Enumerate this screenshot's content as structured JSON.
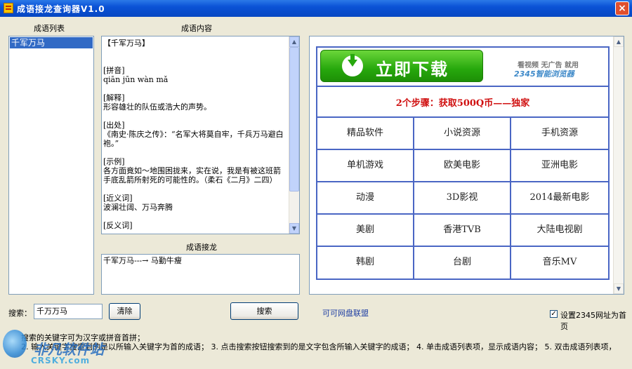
{
  "window": {
    "title": "成语接龙查询器V1.0"
  },
  "labels": {
    "idiom_list": "成语列表",
    "idiom_content": "成语内容",
    "idiom_chain": "成语接龙",
    "search": "搜索："
  },
  "list": {
    "items": [
      "千军万马"
    ]
  },
  "content": {
    "text": "【千军万马】\n\n\n[拼音]\nqiān jūn wàn mǎ\n\n[解释]\n形容雄壮的队伍或浩大的声势。\n\n[出处]\n《南史·陈庆之传》：“名军大将莫自牢，千兵万马避白袍。”\n\n[示例]\n各方面竟如～地围困拢来，实在说，我是有被这班箭手底乱箭所射死的可能性的。（柔石《二月》二四）\n\n[近义词]\n波澜壮阔、万马奔腾\n\n[反义词]"
  },
  "chain": {
    "text": "千军万马---→ 马勤牛瘦"
  },
  "search": {
    "value": "千万万马",
    "clear_label": "清除",
    "search_label": "搜索"
  },
  "link": {
    "text": "可可网盘联盟"
  },
  "homepage": {
    "checked": true,
    "label": "设置2345网址为首页"
  },
  "ad": {
    "download_label": "立即下载",
    "slogan": "看视频 无广告 就用",
    "browser": "2345智能浏览器",
    "steps": "2个步骤：获取500Q币——独家",
    "cells": [
      "精品软件",
      "小说资源",
      "手机资源",
      "单机游戏",
      "欧美电影",
      "亚洲电影",
      "动漫",
      "3D影视",
      "2014最新电影",
      "美剧",
      "香港TVB",
      "大陆电视剧",
      "韩剧",
      "台剧",
      "音乐MV"
    ]
  },
  "help": {
    "line1": "搜索的关键字可为汉字或拼音首拼；",
    "line2": "2. 输入关键字搜索到的是以所输入关键字为首的成语； 3. 点击搜索按钮搜索到的是文字包含所输入关键字的成语； 4. 单击成语列表项，显示成语内容； 5. 双击成语列表项，"
  },
  "watermark": {
    "title": "非凡软件站",
    "site": "CRSKY.com"
  }
}
